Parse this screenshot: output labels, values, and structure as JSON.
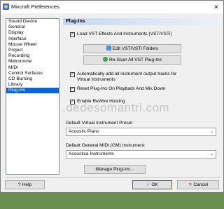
{
  "window": {
    "title": "Mixcraft Preferences",
    "close_glyph": "✕"
  },
  "sidebar": {
    "items": [
      {
        "label": "Sound Device",
        "selected": false
      },
      {
        "label": "General",
        "selected": false
      },
      {
        "label": "Display",
        "selected": false
      },
      {
        "label": "Interface",
        "selected": false
      },
      {
        "label": "Mouse Wheel",
        "selected": false
      },
      {
        "label": "Project",
        "selected": false
      },
      {
        "label": "Recording",
        "selected": false
      },
      {
        "label": "Metronome",
        "selected": false
      },
      {
        "label": "MIDI",
        "selected": false
      },
      {
        "label": "Control Surfaces",
        "selected": false
      },
      {
        "label": "CD Burning",
        "selected": false
      },
      {
        "label": "Library",
        "selected": false
      },
      {
        "label": "Plug-Ins",
        "selected": true
      }
    ]
  },
  "panel": {
    "header": "Plug-Ins",
    "load_vst": {
      "label": "Load VST Effects And Instruments (VST/VSTi)",
      "checked": true
    },
    "edit_folders_label": "Edit VST/VSTi Folders",
    "rescan_label": "Re-Scan All VST Plug-Ins",
    "auto_add": {
      "label_line1": "Automatically add all instrument output tracks for",
      "label_line2": "Virtual Instruments",
      "checked": true
    },
    "reset_plugins": {
      "label": "Reset Plug-Ins On Playback And Mix Down",
      "checked": true
    },
    "rewire": {
      "label": "Enable ReWire Hosting",
      "checked": true
    },
    "default_vi_label": "Default Virtual Instrument Preset",
    "default_vi_value": "Acoustic Piano",
    "default_midi_label": "Default General MIDI (GM) Instrument:",
    "default_midi_value": "Acoustica Instruments",
    "manage_label": "Manage Plug-Ins...",
    "check_glyph": "✓",
    "chevron_glyph": "⌄"
  },
  "watermark": ".dedesomantri.com",
  "footer": {
    "help_label": "Help",
    "ok_label": "OK",
    "cancel_label": "Cancel"
  }
}
